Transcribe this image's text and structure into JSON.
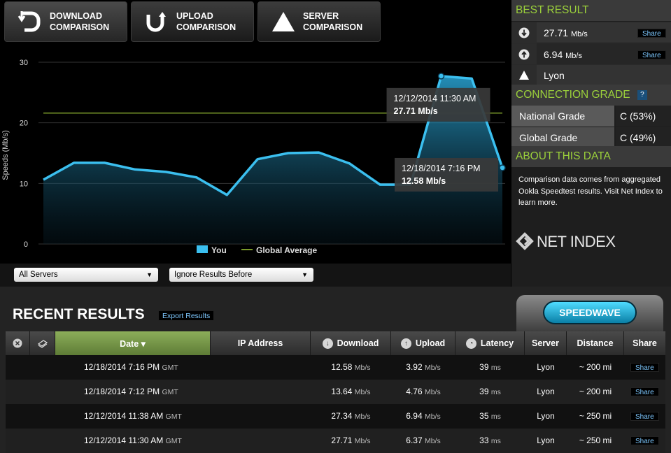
{
  "tabs": [
    {
      "label": "DOWNLOAD\nCOMPARISON",
      "icon": "download-comparison-icon"
    },
    {
      "label": "UPLOAD\nCOMPARISON",
      "icon": "upload-comparison-icon"
    },
    {
      "label": "SERVER\nCOMPARISON",
      "icon": "server-triangle-icon"
    }
  ],
  "chart_data": {
    "type": "line",
    "ylabel": "Speeds (Mb/s)",
    "ylim": [
      0,
      30
    ],
    "y_ticks": [
      "30",
      "20",
      "10",
      "0"
    ],
    "grid": true,
    "legend_position": "bottom-center",
    "series": [
      {
        "name": "You",
        "color": "#3bbfef",
        "values": [
          10.6,
          13.4,
          13.4,
          12.3,
          11.9,
          11.0,
          8.1,
          14.0,
          15.0,
          15.1,
          13.3,
          9.8,
          9.8,
          27.71,
          27.3,
          12.58
        ]
      },
      {
        "name": "Global Average",
        "color": "#7a9a2a",
        "values": [
          21.6
        ]
      }
    ],
    "tooltips": [
      {
        "date": "12/12/2014 11:30 AM",
        "value": "27.71 Mb/s",
        "point_index": 13
      },
      {
        "date": "12/18/2014 7:16 PM",
        "value": "12.58 Mb/s",
        "point_index": 15
      }
    ]
  },
  "filters": {
    "servers": "All Servers",
    "ignore": "Ignore Results Before"
  },
  "best_result": {
    "title": "BEST RESULT",
    "download": {
      "value": "27.71",
      "unit": "Mb/s",
      "share": "Share"
    },
    "upload": {
      "value": "6.94",
      "unit": "Mb/s",
      "share": "Share"
    },
    "server": "Lyon"
  },
  "connection_grade": {
    "title": "CONNECTION GRADE",
    "help": "?",
    "rows": [
      {
        "label": "National Grade",
        "value": "C (53%)"
      },
      {
        "label": "Global Grade",
        "value": "C (49%)"
      }
    ]
  },
  "about": {
    "title": "ABOUT THIS DATA",
    "text": "Comparison data comes from aggregated Ookla Speedtest results. Visit Net Index to learn more.",
    "logo": "NET INDEX"
  },
  "recent": {
    "title": "RECENT RESULTS",
    "export": "Export Results",
    "speedwave": "SPEEDWAVE",
    "columns": [
      "Date ▾",
      "IP Address",
      "Download",
      "Upload",
      "Latency",
      "Server",
      "Distance",
      "Share"
    ],
    "rows": [
      {
        "date": "12/18/2014 7:16 PM",
        "tz": "GMT",
        "ip": "",
        "download": "12.58",
        "upload": "3.92",
        "latency": "39",
        "server": "Lyon",
        "distance": "~ 200 mi",
        "share": "Share"
      },
      {
        "date": "12/18/2014 7:12 PM",
        "tz": "GMT",
        "ip": "",
        "download": "13.64",
        "upload": "4.76",
        "latency": "39",
        "server": "Lyon",
        "distance": "~ 200 mi",
        "share": "Share"
      },
      {
        "date": "12/12/2014 11:38 AM",
        "tz": "GMT",
        "ip": "",
        "download": "27.34",
        "upload": "6.94",
        "latency": "35",
        "server": "Lyon",
        "distance": "~ 250 mi",
        "share": "Share"
      },
      {
        "date": "12/12/2014 11:30 AM",
        "tz": "GMT",
        "ip": "",
        "download": "27.71",
        "upload": "6.37",
        "latency": "33",
        "server": "Lyon",
        "distance": "~ 250 mi",
        "share": "Share"
      }
    ],
    "unit_speed": "Mb/s",
    "unit_latency": "ms"
  }
}
